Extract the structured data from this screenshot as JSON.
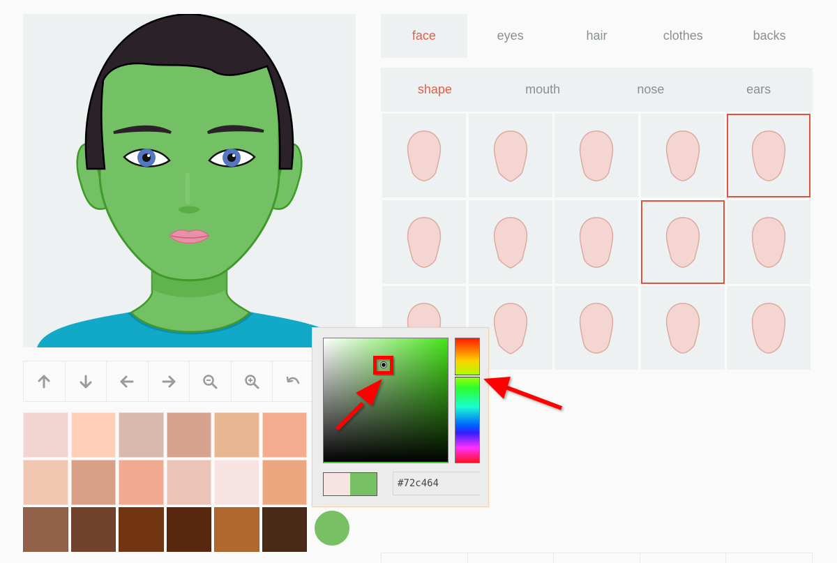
{
  "main_tabs": [
    {
      "label": "face",
      "active": true
    },
    {
      "label": "eyes",
      "active": false
    },
    {
      "label": "hair",
      "active": false
    },
    {
      "label": "clothes",
      "active": false
    },
    {
      "label": "backs",
      "active": false
    }
  ],
  "sub_tabs": [
    {
      "label": "shape",
      "active": true
    },
    {
      "label": "mouth",
      "active": false
    },
    {
      "label": "nose",
      "active": false
    },
    {
      "label": "ears",
      "active": false
    }
  ],
  "toolbar": [
    {
      "name": "move-up",
      "icon": "arrow-up-icon"
    },
    {
      "name": "move-down",
      "icon": "arrow-down-icon"
    },
    {
      "name": "move-left",
      "icon": "arrow-left-icon"
    },
    {
      "name": "move-right",
      "icon": "arrow-right-icon"
    },
    {
      "name": "zoom-out",
      "icon": "zoom-out-icon"
    },
    {
      "name": "zoom-in",
      "icon": "zoom-in-icon"
    },
    {
      "name": "undo",
      "icon": "undo-icon"
    }
  ],
  "skin_swatches": [
    [
      "#f2d5d0",
      "#ffcfba",
      "#d9b8ad",
      "#d8a291",
      "#e8b791",
      "#f4ae8f"
    ],
    [
      "#f1c6b0",
      "#d8a086",
      "#f1a98f",
      "#ebc3b7",
      "#f7e4e2",
      "#eda780"
    ],
    [
      "#93604a",
      "#71432e",
      "#713611",
      "#57270f",
      "#b1682f",
      "#4a2b18"
    ]
  ],
  "current_color": "#77c064",
  "face_shapes": {
    "count": 15,
    "selected": [
      4,
      8
    ]
  },
  "color_picker": {
    "hex_value": "#72c464",
    "previous_color": "#f7e4e2",
    "new_color": "#77c064"
  },
  "colors": {
    "accent": "#e35f48",
    "selection_border": "#e0533a",
    "skin": "#74c064",
    "skin_shadow": "#3f9a2a",
    "hair": "#2a2129",
    "shirt": "#12a9c8",
    "face_shape_fill": "#f4d5d1",
    "face_shape_stroke": "#dba99f"
  }
}
